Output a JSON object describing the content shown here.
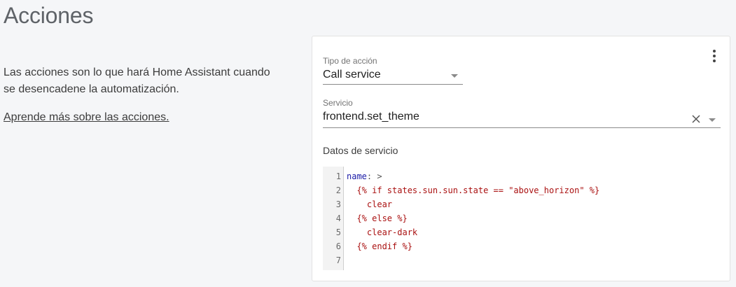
{
  "page": {
    "title": "Acciones",
    "description": "Las acciones son lo que hará Home Assistant cuando se desencadene la automatización.",
    "learn_more": "Aprende más sobre las acciones."
  },
  "action_card": {
    "action_type": {
      "label": "Tipo de acción",
      "value": "Call service"
    },
    "service": {
      "label": "Servicio",
      "value": "frontend.set_theme"
    },
    "service_data": {
      "label": "Datos de servicio",
      "line_numbers": [
        "1",
        "2",
        "3",
        "4",
        "5",
        "6",
        "7"
      ],
      "lines": {
        "l1_key": "name",
        "l1_rest": ": >",
        "l2": "  {% if states.sun.sun.state == \"above_horizon\" %}",
        "l3": "    clear",
        "l4": "  {% else %}",
        "l5": "    clear-dark",
        "l6": "  {% endif %}",
        "l7": ""
      }
    }
  },
  "icons": {
    "menu": "more-vertical-icon",
    "clear": "close-icon",
    "dropdown": "arrow-drop-down-icon"
  },
  "colors": {
    "background": "#f5f6f8",
    "card": "#ffffff",
    "code_key": "#1a1aa6",
    "code_value": "#aa1111"
  }
}
